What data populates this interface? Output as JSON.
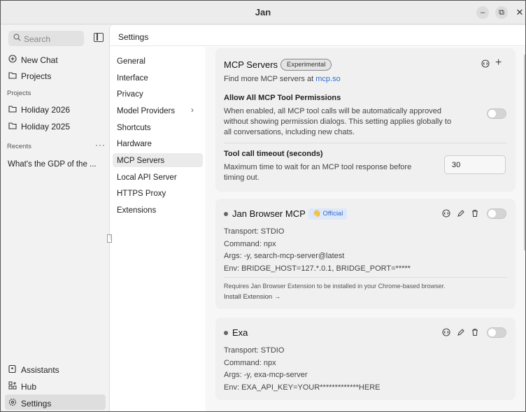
{
  "window": {
    "title": "Jan",
    "minimize": "–",
    "restore": "⧉",
    "close": "✕"
  },
  "sidebar": {
    "search_placeholder": "Search",
    "new_chat": "New Chat",
    "projects": "Projects",
    "projects_label": "Projects",
    "project_items": [
      "Holiday 2026",
      "Holiday 2025"
    ],
    "recents_label": "Recents",
    "recents_more": "···",
    "recent_items": [
      "What's the GDP of the ..."
    ],
    "assistants": "Assistants",
    "hub": "Hub",
    "settings": "Settings"
  },
  "main": {
    "header": "Settings",
    "nav": [
      "General",
      "Interface",
      "Privacy",
      "Model Providers",
      "Shortcuts",
      "Hardware",
      "MCP Servers",
      "Local API Server",
      "HTTPS Proxy",
      "Extensions"
    ],
    "active_nav": "MCP Servers"
  },
  "mcp_card": {
    "title": "MCP Servers",
    "badge": "Experimental",
    "find_more": "Find more MCP servers at",
    "find_more_link": "mcp.so",
    "allow_title": "Allow All MCP Tool Permissions",
    "allow_desc_1": "When enabled, all MCP tool calls will be automatically approved",
    "allow_desc_2": "without showing permission dialogs. This setting applies globally to",
    "allow_desc_3": "all conversations, including new chats.",
    "timeout_title": "Tool call timeout (seconds)",
    "timeout_desc_1": "Maximum time to wait for an MCP tool response before",
    "timeout_desc_2": "timing out.",
    "timeout_value": "30"
  },
  "servers": [
    {
      "name": "Jan Browser MCP",
      "badge": "👋 Official",
      "transport": "Transport: STDIO",
      "command": "Command: npx",
      "args": "Args: -y, search-mcp-server@latest",
      "env": "Env: BRIDGE_HOST=127.*.0.1, BRIDGE_PORT=*****",
      "note": "Requires Jan Browser Extension to be installed in your Chrome-based browser.",
      "install": "Install Extension →"
    },
    {
      "name": "Exa",
      "transport": "Transport: STDIO",
      "command": "Command: npx",
      "args": "Args: -y, exa-mcp-server",
      "env": "Env: EXA_API_KEY=YOUR*************HERE"
    }
  ],
  "icons": {
    "search": "search-icon",
    "new_chat": "plus-circle-icon",
    "folder": "folder-icon",
    "assistants": "assistant-icon",
    "hub": "grid-icon",
    "settings": "gear-icon",
    "chevron": "chevron-right-icon",
    "edit": "pencil-icon",
    "delete": "trash-icon",
    "expand": "code-circle-icon",
    "add": "plus-icon"
  },
  "colors": {
    "accent_link": "#2f6fd6",
    "official_badge": "#dde8fb"
  }
}
